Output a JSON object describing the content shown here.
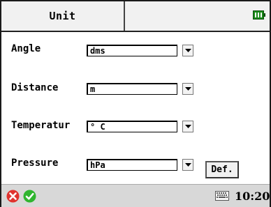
{
  "header": {
    "title": "Unit",
    "battery_icon": "battery-full-icon",
    "battery_color": "#1a8a1a"
  },
  "settings": {
    "angle": {
      "label": "Angle",
      "value": "dms"
    },
    "distance": {
      "label": "Distance",
      "value": "m"
    },
    "temperature": {
      "label": "Temperatur",
      "value": "° C"
    },
    "pressure": {
      "label": "Pressure",
      "value": "hPa"
    }
  },
  "buttons": {
    "def_label": "Def."
  },
  "taskbar": {
    "cancel_icon": "red-x-circle-icon",
    "ok_icon": "green-check-circle-icon",
    "keyboard_icon": "keyboard-icon",
    "time": "10:20",
    "cancel_color": "#e0322e",
    "ok_color": "#2fb52f"
  }
}
